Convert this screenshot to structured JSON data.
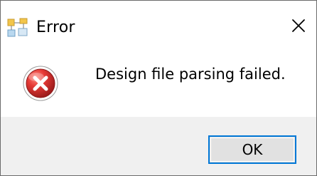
{
  "window": {
    "title": "Error",
    "app_icon": "app-window-icon",
    "close_icon": "close-icon",
    "close_glyph": "✕"
  },
  "dialog": {
    "icon": "error-icon",
    "message": "Design file parsing failed."
  },
  "buttons": {
    "ok_label": "OK"
  },
  "colors": {
    "error_red": "#d8352e",
    "focus_border": "#0078d7",
    "footer_background": "#f0f0f0"
  }
}
